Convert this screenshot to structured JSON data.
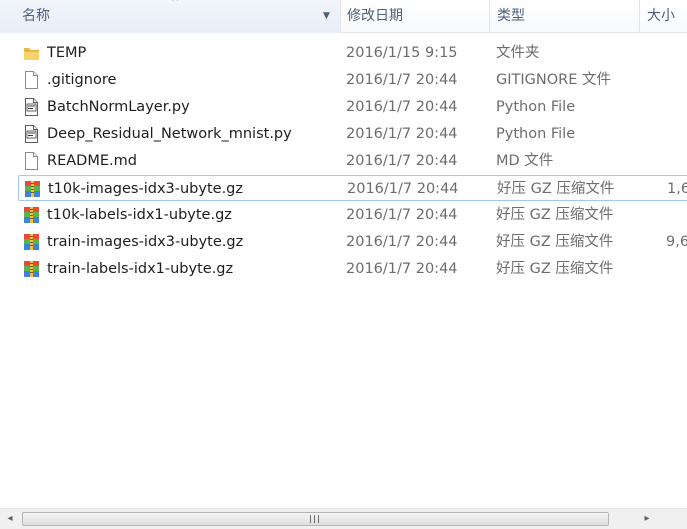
{
  "header": {
    "name_label": "名称",
    "date_label": "修改日期",
    "type_label": "类型",
    "size_label": "大小",
    "sort_glyph": "^",
    "dropdown_glyph": "▼"
  },
  "files": [
    {
      "name": "TEMP",
      "date": "2016/1/15 9:15",
      "type": "文件夹",
      "size": "",
      "icon": "folder-icon"
    },
    {
      "name": ".gitignore",
      "date": "2016/1/7 20:44",
      "type": "GITIGNORE 文件",
      "size": "",
      "icon": "file-icon"
    },
    {
      "name": "BatchNormLayer.py",
      "date": "2016/1/7 20:44",
      "type": "Python File",
      "size": "",
      "icon": "python-file-icon"
    },
    {
      "name": "Deep_Residual_Network_mnist.py",
      "date": "2016/1/7 20:44",
      "type": "Python File",
      "size": "",
      "icon": "python-file-icon"
    },
    {
      "name": "README.md",
      "date": "2016/1/7 20:44",
      "type": "MD 文件",
      "size": "",
      "icon": "file-icon"
    },
    {
      "name": "t10k-images-idx3-ubyte.gz",
      "date": "2016/1/7 20:44",
      "type": "好压 GZ 压缩文件",
      "size": "1,6",
      "icon": "archive-icon",
      "selected": true
    },
    {
      "name": "t10k-labels-idx1-ubyte.gz",
      "date": "2016/1/7 20:44",
      "type": "好压 GZ 压缩文件",
      "size": "",
      "icon": "archive-icon"
    },
    {
      "name": "train-images-idx3-ubyte.gz",
      "date": "2016/1/7 20:44",
      "type": "好压 GZ 压缩文件",
      "size": "9,6",
      "icon": "archive-icon"
    },
    {
      "name": "train-labels-idx1-ubyte.gz",
      "date": "2016/1/7 20:44",
      "type": "好压 GZ 压缩文件",
      "size": "",
      "icon": "archive-icon"
    }
  ],
  "scrollbar": {
    "left_glyph": "◂",
    "right_glyph": "▸"
  }
}
